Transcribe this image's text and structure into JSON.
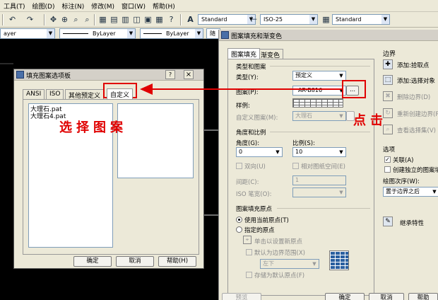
{
  "menubar": [
    "工具(T)",
    "绘图(D)",
    "标注(N)",
    "修改(M)",
    "窗口(W)",
    "帮助(H)"
  ],
  "toolbar": {
    "text_style": "Standard",
    "dim_style": "ISO-25",
    "table_style": "Standard"
  },
  "layerbar": {
    "layer": "ayer",
    "linetype": "ByLayer",
    "lineweight": "ByLayer",
    "plotstyle": "随"
  },
  "main_dialog": {
    "title": "图案填充和渐变色",
    "tabs": [
      "图案填充",
      "渐变色"
    ],
    "section_type": "类型和图案",
    "type_label": "类型(Y):",
    "type_value": "预定义",
    "pattern_label": "图案(P):",
    "pattern_value": "AR-B816",
    "browse_button": "...",
    "sample_label": "样例:",
    "custom_label": "自定义图案(M):",
    "custom_value": "大理石",
    "section_angle": "角度和比例",
    "angle_label": "角度(G):",
    "angle_value": "0",
    "scale_label": "比例(S):",
    "scale_value": "10",
    "double_label": "双向(U)",
    "relative_label": "相对图纸空间(E)",
    "spacing_label": "间距(C):",
    "spacing_value": "1",
    "iso_label": "ISO 笔宽(O):",
    "section_origin": "图案填充原点",
    "origin_current": "使用当前原点(T)",
    "origin_specified": "指定的原点",
    "click_set": "单击以设置新原点",
    "default_extent": "默认为边界范围(X)",
    "extent_value": "左下",
    "store_default": "存储为默认原点(F)",
    "boundary_header": "边界",
    "add_pick": "添加:拾取点",
    "add_select": "添加:选择对象",
    "remove_boundary": "删除边界(D)",
    "recreate_boundary": "重新创建边界(R)",
    "view_selection": "查看选择集(V)",
    "options_header": "选项",
    "associative": "关联(A)",
    "separate": "创建独立的图案填",
    "draw_order_label": "绘图次序(W):",
    "draw_order_value": "置于边界之后",
    "inherit": "继承特性",
    "preview_btn": "预览",
    "ok_btn": "确定",
    "cancel_btn": "取消",
    "help_btn": "帮助"
  },
  "small_dialog": {
    "title": "填充图案选项板",
    "tabs": [
      "ANSI",
      "ISO",
      "其他预定义",
      "自定义"
    ],
    "files": [
      "大理石.pat",
      "大理石4.pat"
    ],
    "ok_btn": "确定",
    "cancel_btn": "取消",
    "help_btn": "帮助(H)",
    "help_q": "?",
    "close_x": "×"
  },
  "annotations": {
    "select_pattern": "选择图案",
    "click": "点击",
    "color": "#e00000"
  }
}
